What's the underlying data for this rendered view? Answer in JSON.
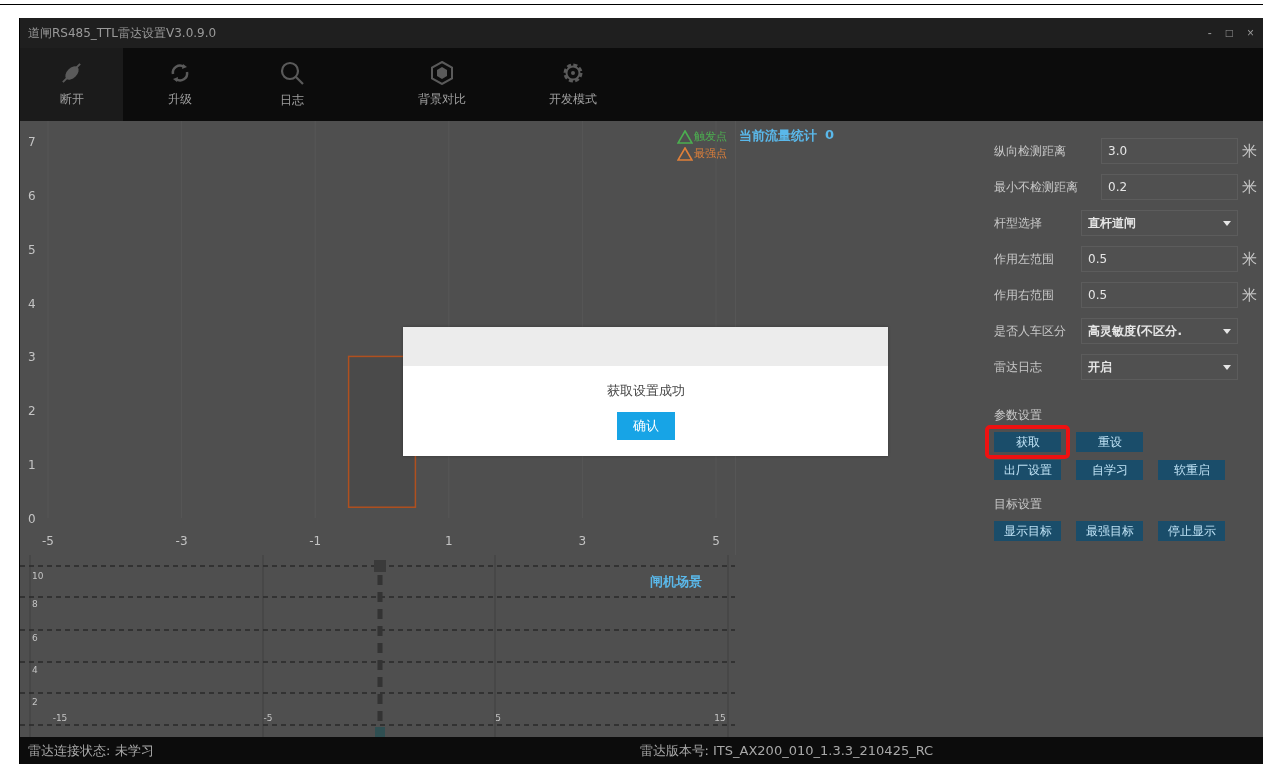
{
  "window": {
    "title": "道闸RS485_TTL雷达设置V3.0.9.0",
    "controls": [
      "-",
      "□",
      "×"
    ]
  },
  "toolbar": [
    {
      "label": "断开",
      "selected": true
    },
    {
      "label": "升级",
      "selected": false
    },
    {
      "label": "日志",
      "selected": false
    },
    {
      "label": "背景对比",
      "selected": false
    },
    {
      "label": "开发模式",
      "selected": false
    }
  ],
  "detection_chart": {
    "legend": [
      {
        "label": "触发点",
        "color": "#4caf50"
      },
      {
        "label": "最强点",
        "color": "#e0803a"
      }
    ],
    "chart_data": {
      "type": "scatter",
      "xlim": [
        -5,
        5
      ],
      "ylim": [
        0,
        7
      ],
      "xticks": [
        -5,
        -3,
        -1,
        1,
        3,
        5
      ],
      "yticks": [
        0,
        1,
        2,
        3,
        4,
        5,
        6,
        7
      ]
    }
  },
  "traffic": {
    "label": "当前流量统计",
    "count": "0"
  },
  "scene_chart": {
    "title": "闸机场景",
    "y_labels": [
      "10",
      "8",
      "6",
      "4",
      "2"
    ],
    "x_labels": [
      "-15",
      "-5",
      "5",
      "15"
    ]
  },
  "settings": [
    {
      "kind": "input",
      "label": "纵向检测距离",
      "value": "3.0",
      "unit": "米"
    },
    {
      "kind": "input",
      "label": "最小不检测距离",
      "value": "0.2",
      "unit": "米"
    },
    {
      "kind": "select",
      "label": "杆型选择",
      "value": "直杆道闸"
    },
    {
      "kind": "input",
      "label": "作用左范围",
      "value": "0.5",
      "unit": "米"
    },
    {
      "kind": "input",
      "label": "作用右范围",
      "value": "0.5",
      "unit": "米"
    },
    {
      "kind": "select",
      "label": "是否人车区分",
      "value": "高灵敏度(不区分."
    },
    {
      "kind": "select",
      "label": "雷达日志",
      "value": "开启"
    }
  ],
  "sections": [
    {
      "title": "参数设置",
      "rows": [
        [
          {
            "label": "获取",
            "highlighted": true
          },
          {
            "label": "重设",
            "highlighted": false
          }
        ],
        [
          {
            "label": "出厂设置",
            "highlighted": false
          },
          {
            "label": "自学习",
            "highlighted": false
          },
          {
            "label": "软重启",
            "highlighted": false
          }
        ]
      ]
    },
    {
      "title": "目标设置",
      "rows": [
        [
          {
            "label": "显示目标",
            "highlighted": false
          },
          {
            "label": "最强目标",
            "highlighted": false
          },
          {
            "label": "停止显示",
            "highlighted": false
          }
        ]
      ]
    }
  ],
  "status_bar": {
    "connection": "雷达连接状态: 未学习",
    "version": "雷达版本号: ITS_AX200_010_1.3.3_210425_RC"
  },
  "dialog": {
    "message": "获取设置成功",
    "button": "确认"
  }
}
